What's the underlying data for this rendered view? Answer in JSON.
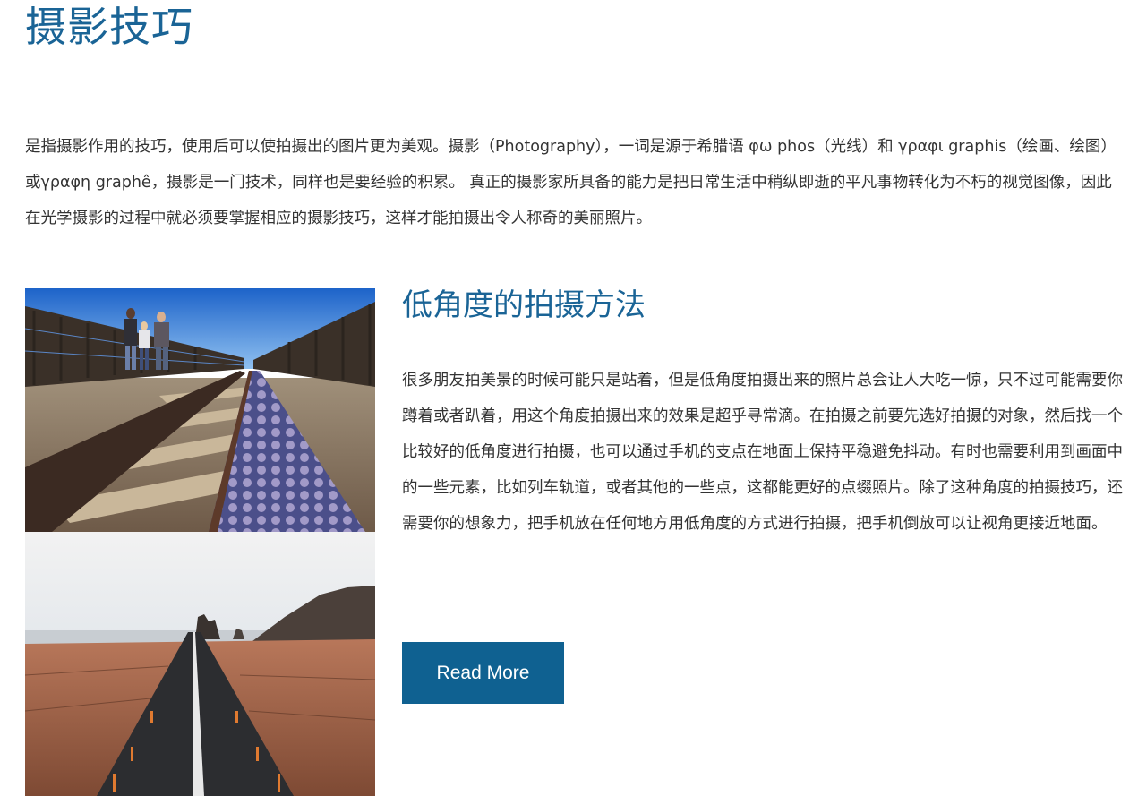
{
  "page": {
    "title": "摄影技巧",
    "intro": "是指摄影作用的技巧，使用后可以使拍摄出的图片更为美观。摄影（Photography），一词是源于希腊语 φω phos（光线）和 γραφι graphis（绘画、绘图）或γραφη graphê，摄影是一门技术，同样也是要经验的积累。 真正的摄影家所具备的能力是把日常生活中稍纵即逝的平凡事物转化为不朽的视觉图像，因此在光学摄影的过程中就必须要掌握相应的摄影技巧，这样才能拍摄出令人称奇的美丽照片。"
  },
  "article": {
    "title": "低角度的拍摄方法",
    "body": "很多朋友拍美景的时候可能只是站着，但是低角度拍摄出来的照片总会让人大吃一惊，只不过可能需要你蹲着或者趴着，用这个角度拍摄出来的效果是超乎寻常滴。在拍摄之前要先选好拍摄的对象，然后找一个比较好的低角度进行拍摄，也可以通过手机的支点在地面上保持平稳避免抖动。有时也需要利用到画面中的一些元素，比如列车轨道，或者其他的一些点，这都能更好的点缀照片。除了这种角度的拍摄技巧，还需要你的想象力，把手机放在任何地方用低角度的方式进行拍摄，把手机倒放可以让视角更接近地面。",
    "read_more_label": "Read More"
  },
  "colors": {
    "heading": "#1a6496",
    "button_bg": "#0f6191",
    "button_text": "#ffffff",
    "body_text": "#333333"
  }
}
